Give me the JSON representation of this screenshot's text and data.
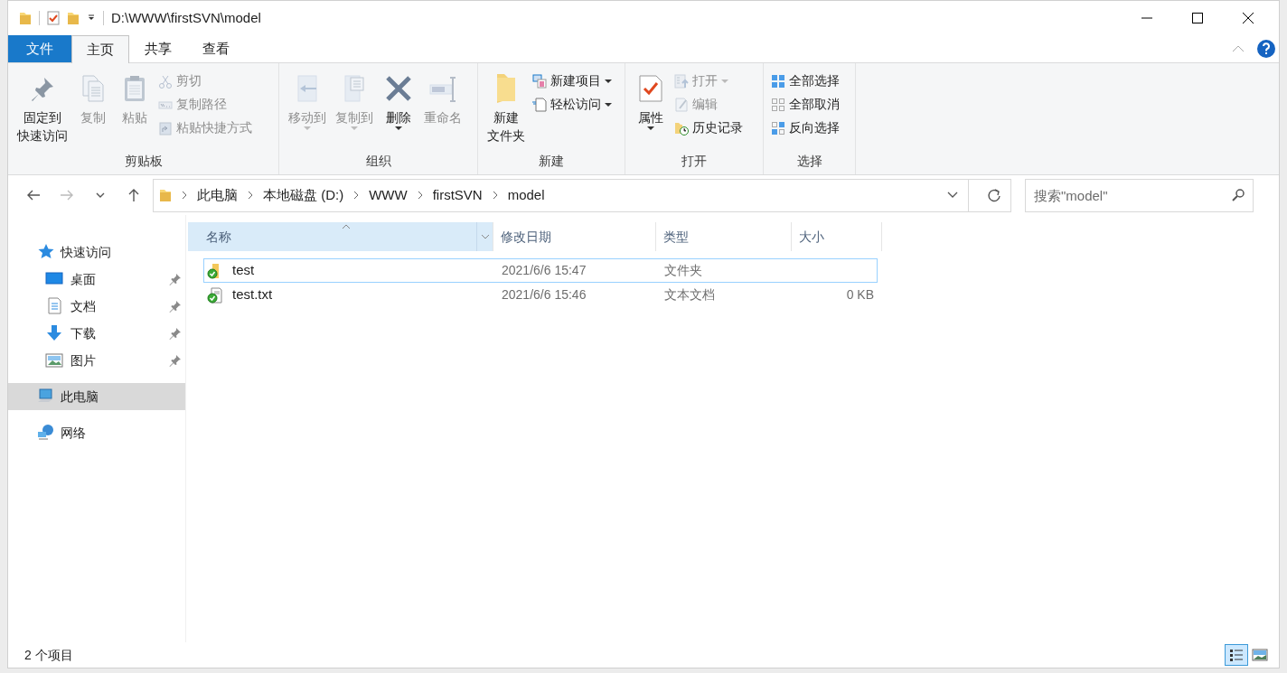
{
  "window": {
    "title": "D:\\WWW\\firstSVN\\model"
  },
  "tabs": [
    {
      "label": "文件",
      "kind": "file"
    },
    {
      "label": "主页",
      "kind": "tab",
      "selected": true
    },
    {
      "label": "共享",
      "kind": "tab",
      "selected": false
    },
    {
      "label": "查看",
      "kind": "tab",
      "selected": false
    }
  ],
  "ribbon": {
    "groups": [
      {
        "label": "剪贴板",
        "items": [
          {
            "kind": "large",
            "label_lines": [
              "固定到",
              "快速访问"
            ],
            "disabled": false,
            "dropdown": false
          },
          {
            "kind": "large",
            "label": "复制",
            "disabled": true,
            "dropdown": false
          },
          {
            "kind": "large",
            "label": "粘贴",
            "disabled": true,
            "dropdown": false
          },
          {
            "kind": "small",
            "label": "剪切",
            "disabled": true,
            "dropdown": false
          },
          {
            "kind": "small",
            "label": "复制路径",
            "disabled": true,
            "dropdown": false
          },
          {
            "kind": "small",
            "label": "粘贴快捷方式",
            "disabled": true,
            "dropdown": false
          }
        ]
      },
      {
        "label": "组织",
        "items": [
          {
            "kind": "large",
            "label": "移动到",
            "disabled": true,
            "dropdown": true
          },
          {
            "kind": "large",
            "label": "复制到",
            "disabled": true,
            "dropdown": true
          },
          {
            "kind": "large",
            "label": "删除",
            "disabled": false,
            "dropdown": true
          },
          {
            "kind": "large",
            "label": "重命名",
            "disabled": true,
            "dropdown": false
          }
        ]
      },
      {
        "label": "新建",
        "items": [
          {
            "kind": "large",
            "label_lines": [
              "新建",
              "文件夹"
            ],
            "disabled": false,
            "dropdown": false
          },
          {
            "kind": "small",
            "label": "新建项目",
            "disabled": false,
            "dropdown": true
          },
          {
            "kind": "small",
            "label": "轻松访问",
            "disabled": false,
            "dropdown": true
          }
        ]
      },
      {
        "label": "打开",
        "items": [
          {
            "kind": "large",
            "label": "属性",
            "disabled": false,
            "dropdown": true
          },
          {
            "kind": "small",
            "label": "打开",
            "disabled": true,
            "dropdown": true
          },
          {
            "kind": "small",
            "label": "编辑",
            "disabled": true,
            "dropdown": false
          },
          {
            "kind": "small",
            "label": "历史记录",
            "disabled": false,
            "dropdown": false
          }
        ]
      },
      {
        "label": "选择",
        "items": [
          {
            "kind": "small",
            "label": "全部选择",
            "disabled": false,
            "dropdown": false
          },
          {
            "kind": "small",
            "label": "全部取消",
            "disabled": false,
            "dropdown": false
          },
          {
            "kind": "small",
            "label": "反向选择",
            "disabled": false,
            "dropdown": false
          }
        ]
      }
    ]
  },
  "address": {
    "crumbs": [
      "此电脑",
      "本地磁盘 (D:)",
      "WWW",
      "firstSVN",
      "model"
    ]
  },
  "search": {
    "placeholder": "搜索\"model\""
  },
  "sidebar": {
    "items": [
      {
        "label": "快速访问",
        "selected": false,
        "children": [
          {
            "label": "桌面",
            "pinned": true
          },
          {
            "label": "文档",
            "pinned": true
          },
          {
            "label": "下载",
            "pinned": true
          },
          {
            "label": "图片",
            "pinned": true
          }
        ]
      },
      {
        "label": "此电脑",
        "selected": true
      },
      {
        "label": "网络",
        "selected": false
      }
    ]
  },
  "table": {
    "columns": [
      {
        "label": "名称",
        "sorted": true
      },
      {
        "label": "修改日期",
        "sorted": false
      },
      {
        "label": "类型",
        "sorted": false
      },
      {
        "label": "大小",
        "sorted": false
      }
    ],
    "rows": [
      {
        "kind": "folder",
        "name": "test",
        "modified": "2021/6/6 15:47",
        "type": "文件夹",
        "focused": true
      },
      {
        "kind": "file",
        "name": "test.txt",
        "modified": "2021/6/6 15:46",
        "type": "文本文档",
        "size": "0 KB",
        "focused": false
      }
    ]
  },
  "status_bar": {
    "text": "2 个项目",
    "views": [
      {
        "kind": "details",
        "selected": true
      },
      {
        "kind": "large",
        "selected": false
      }
    ]
  }
}
